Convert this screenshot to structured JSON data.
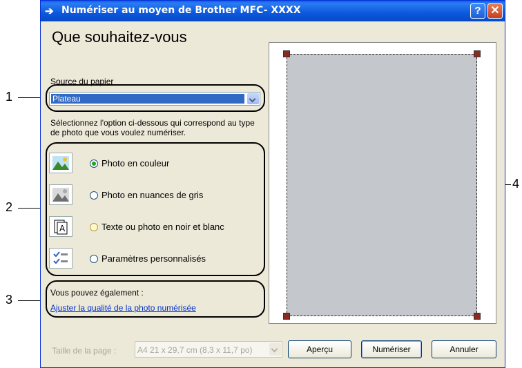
{
  "window": {
    "title": "Numériser au moyen de Brother MFC-",
    "title_model": "XXXX",
    "help_label": "?",
    "close_label": "✕"
  },
  "heading": "Que souhaitez-vous",
  "paper_source": {
    "label": "Source du papier",
    "selected": "Plateau"
  },
  "description": "Sélectionnez l'option ci-dessous qui correspond au type de photo que vous voulez numériser.",
  "options": [
    {
      "label": "Photo en couleur",
      "icon": "color-photo-icon",
      "checked": true
    },
    {
      "label": "Photo en nuances de gris",
      "icon": "grayscale-photo-icon",
      "checked": false
    },
    {
      "label": "Texte ou photo en noir et blanc",
      "icon": "bw-text-icon",
      "checked": false
    },
    {
      "label": "Paramètres personnalisés",
      "icon": "custom-settings-icon",
      "checked": false
    }
  ],
  "also": {
    "label": "Vous pouvez également :",
    "link": "Ajuster la qualité de la photo numérisée"
  },
  "page_size": {
    "label": "Taille de la page :",
    "value": "A4 21 x 29,7 cm (8,3 x 11,7 po)"
  },
  "buttons": {
    "preview": "Aperçu",
    "scan": "Numériser",
    "cancel": "Annuler"
  },
  "callouts": [
    "1",
    "2",
    "3",
    "4"
  ],
  "colors": {
    "titlebar": "#0a5fe8",
    "dialog_bg": "#ece9d8",
    "selection": "#316ac5",
    "preview_area": "#c4c7cc",
    "link": "#0033cc"
  }
}
